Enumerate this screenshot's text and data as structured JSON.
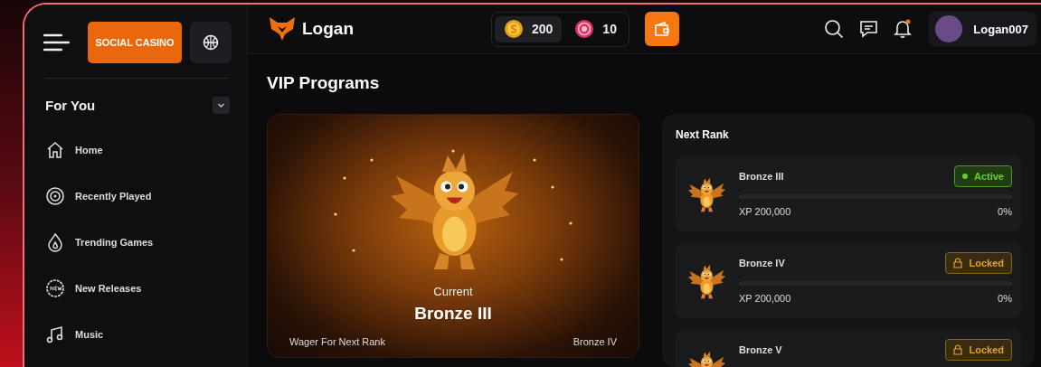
{
  "top_left": {
    "mode_button": "SOCIAL CASINO"
  },
  "sidebar": {
    "section_title": "For You",
    "expanded": true,
    "items": [
      {
        "label": "Home"
      },
      {
        "label": "Recently Played"
      },
      {
        "label": "Trending Games"
      },
      {
        "label": "New Releases"
      },
      {
        "label": "Music"
      }
    ]
  },
  "header": {
    "brand": "Logan",
    "balances": [
      {
        "kind": "coin",
        "amount": "200",
        "selected": true
      },
      {
        "kind": "chip",
        "amount": "10",
        "selected": false
      }
    ],
    "notifications_unread": true,
    "username": "Logan007"
  },
  "page_title": "VIP Programs",
  "current_rank": {
    "caption": "Current",
    "rank": "Bronze III",
    "wager_label": "Wager For Next Rank",
    "next_rank": "Bronze IV"
  },
  "next_rank_panel": {
    "title": "Next Rank",
    "ranks": [
      {
        "name": "Bronze III",
        "kind": "active",
        "badge": "Active",
        "level": 0,
        "xp": "XP 200,000",
        "percent": "0%"
      },
      {
        "name": "Bronze IV",
        "kind": "locked",
        "badge": "Locked",
        "level": 0,
        "xp": "XP 200,000",
        "percent": "0%"
      },
      {
        "name": "Bronze V",
        "kind": "locked",
        "badge": "Locked"
      }
    ]
  }
}
